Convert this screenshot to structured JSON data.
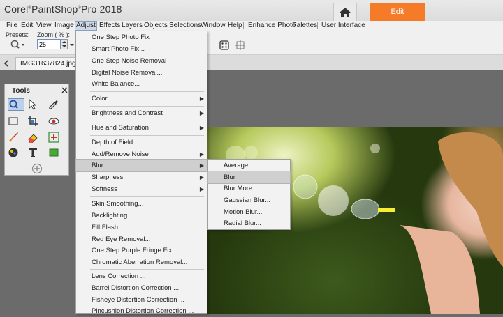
{
  "title_bar": {
    "brand": "Corel",
    "product": "PaintShop",
    "suffix": "Pro 2018",
    "edit_tab": "Edit"
  },
  "menubar": [
    "File",
    "Edit",
    "View",
    "Image",
    "Adjust",
    "Effects",
    "Layers",
    "Objects",
    "Selections",
    "Window",
    "Help",
    "Enhance Photo",
    "Palettes",
    "User Interface"
  ],
  "tool_options": {
    "presets_label": "Presets:",
    "zoom_label": "Zoom ( % ):",
    "zoom_value": "25"
  },
  "document_tab": "IMG31637824.jpg @",
  "tools_palette": {
    "title": "Tools"
  },
  "adjust_menu": [
    "One Step Photo Fix",
    "Smart Photo Fix...",
    "One Step Noise Removal",
    "Digital Noise Removal...",
    "White Balance...",
    "Color",
    "Brightness and Contrast",
    "Hue and Saturation",
    "Depth of Field...",
    "Add/Remove Noise",
    "Blur",
    "Sharpness",
    "Softness",
    "Skin Smoothing...",
    "Backlighting...",
    "Fill Flash...",
    "Red Eye Removal...",
    "One Step Purple Fringe Fix",
    "Chromatic Aberration Removal...",
    "Lens Correction ...",
    "Barrel Distortion Correction ...",
    "Fisheye Distortion Correction ...",
    "Pincushion Distortion Correction ..."
  ],
  "blur_submenu": [
    "Average...",
    "Blur",
    "Blur More",
    "Gaussian Blur...",
    "Motion Blur...",
    "Radial Blur..."
  ],
  "colors": {
    "accent": "#f57b29",
    "menu_highlight": "#cfcfcf"
  }
}
